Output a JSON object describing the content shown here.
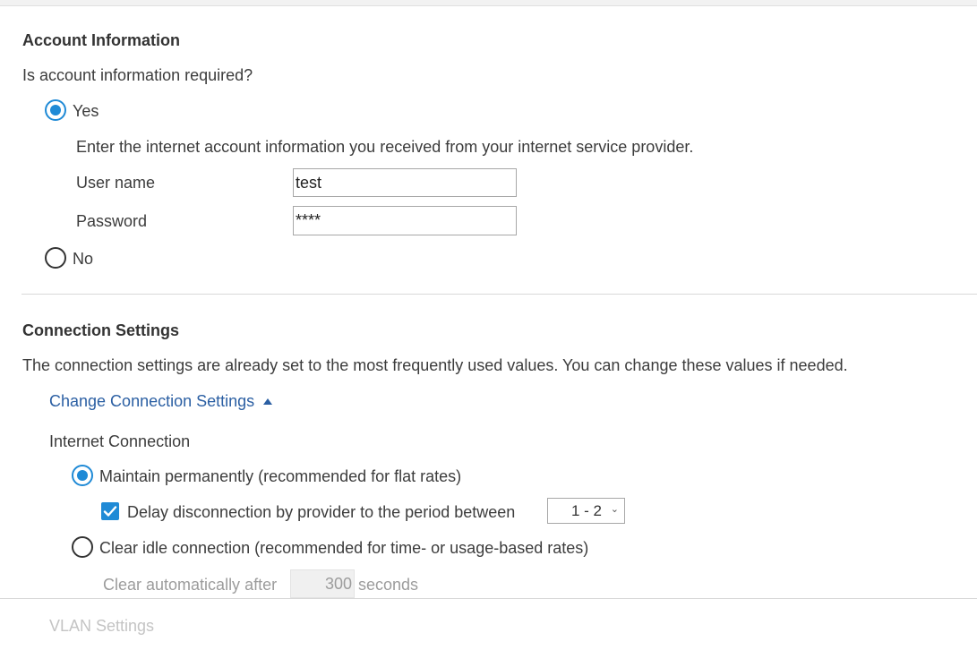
{
  "account": {
    "heading": "Account Information",
    "question": "Is account information required?",
    "yes_label": "Yes",
    "instruction": "Enter the internet account information you received from your internet service provider.",
    "username_label": "User name",
    "username_value": "test",
    "password_label": "Password",
    "password_value": "****",
    "no_label": "No",
    "selected": "Yes"
  },
  "connection": {
    "heading": "Connection Settings",
    "description": "The connection settings are already set to the most frequently used values. You can change these values if needed.",
    "change_link": "Change Connection Settings",
    "internet_connection_label": "Internet Connection",
    "maintain_label": "Maintain permanently (recommended for flat rates)",
    "delay_label": "Delay disconnection by provider to the period between",
    "delay_checked": true,
    "delay_period": "1 - 2",
    "clear_label": "Clear idle connection (recommended for time- or usage-based rates)",
    "clear_auto_label": "Clear automatically after",
    "clear_seconds_value": "300",
    "seconds_label": "seconds",
    "selected": "Maintain permanently"
  },
  "vlan": {
    "heading": "VLAN Settings"
  },
  "colors": {
    "accent": "#1f8ad6",
    "link": "#2b5fa3"
  }
}
